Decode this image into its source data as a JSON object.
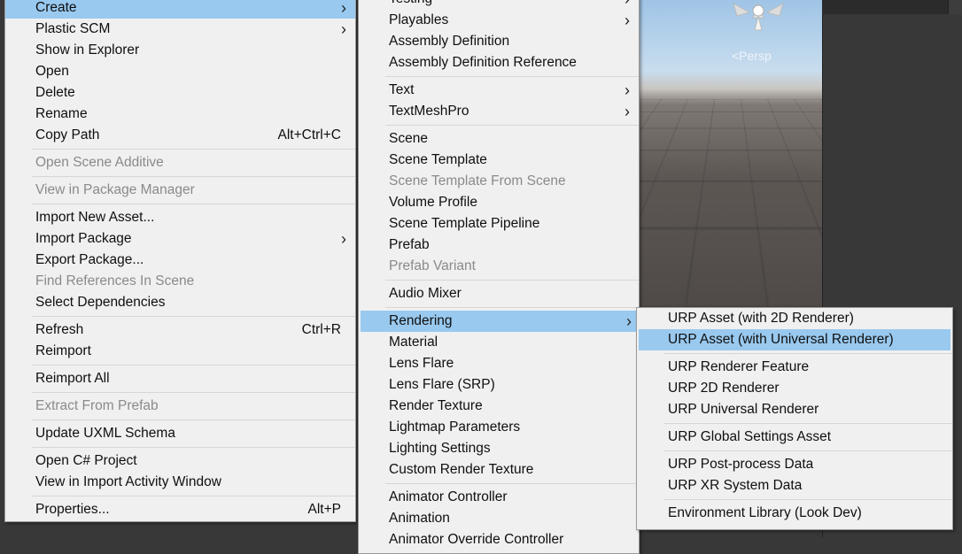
{
  "scene": {
    "persp_label": "<Persp"
  },
  "main_menu": {
    "items": [
      {
        "label": "Create",
        "submenu": true,
        "highlighted": true
      },
      {
        "label": "Plastic SCM",
        "submenu": true
      },
      {
        "label": "Show in Explorer"
      },
      {
        "label": "Open"
      },
      {
        "label": "Delete"
      },
      {
        "label": "Rename"
      },
      {
        "label": "Copy Path",
        "shortcut": "Alt+Ctrl+C"
      },
      {
        "separator": true
      },
      {
        "label": "Open Scene Additive",
        "disabled": true
      },
      {
        "separator": true
      },
      {
        "label": "View in Package Manager",
        "disabled": true
      },
      {
        "separator": true
      },
      {
        "label": "Import New Asset..."
      },
      {
        "label": "Import Package",
        "submenu": true
      },
      {
        "label": "Export Package..."
      },
      {
        "label": "Find References In Scene",
        "disabled": true
      },
      {
        "label": "Select Dependencies"
      },
      {
        "separator": true
      },
      {
        "label": "Refresh",
        "shortcut": "Ctrl+R"
      },
      {
        "label": "Reimport"
      },
      {
        "separator": true
      },
      {
        "label": "Reimport All"
      },
      {
        "separator": true
      },
      {
        "label": "Extract From Prefab",
        "disabled": true
      },
      {
        "separator": true
      },
      {
        "label": "Update UXML Schema"
      },
      {
        "separator": true
      },
      {
        "label": "Open C# Project"
      },
      {
        "label": "View in Import Activity Window"
      },
      {
        "separator": true
      },
      {
        "label": "Properties...",
        "shortcut": "Alt+P"
      }
    ]
  },
  "create_menu": {
    "items": [
      {
        "label": "Testing",
        "submenu": true
      },
      {
        "label": "Playables",
        "submenu": true
      },
      {
        "label": "Assembly Definition"
      },
      {
        "label": "Assembly Definition Reference"
      },
      {
        "separator": true
      },
      {
        "label": "Text",
        "submenu": true
      },
      {
        "label": "TextMeshPro",
        "submenu": true
      },
      {
        "separator": true
      },
      {
        "label": "Scene"
      },
      {
        "label": "Scene Template"
      },
      {
        "label": "Scene Template From Scene",
        "disabled": true
      },
      {
        "label": "Volume Profile"
      },
      {
        "label": "Scene Template Pipeline"
      },
      {
        "label": "Prefab"
      },
      {
        "label": "Prefab Variant",
        "disabled": true
      },
      {
        "separator": true
      },
      {
        "label": "Audio Mixer"
      },
      {
        "separator": true
      },
      {
        "label": "Rendering",
        "submenu": true,
        "highlighted": true
      },
      {
        "label": "Material"
      },
      {
        "label": "Lens Flare"
      },
      {
        "label": "Lens Flare (SRP)"
      },
      {
        "label": "Render Texture"
      },
      {
        "label": "Lightmap Parameters"
      },
      {
        "label": "Lighting Settings"
      },
      {
        "label": "Custom Render Texture"
      },
      {
        "separator": true
      },
      {
        "label": "Animator Controller"
      },
      {
        "label": "Animation"
      },
      {
        "label": "Animator Override Controller"
      }
    ]
  },
  "rendering_menu": {
    "items": [
      {
        "label": "URP Asset (with 2D Renderer)"
      },
      {
        "label": "URP Asset (with Universal Renderer)",
        "highlighted": true
      },
      {
        "separator": true
      },
      {
        "label": "URP Renderer Feature"
      },
      {
        "label": "URP 2D Renderer"
      },
      {
        "label": "URP Universal Renderer"
      },
      {
        "separator": true
      },
      {
        "label": "URP Global Settings Asset"
      },
      {
        "separator": true
      },
      {
        "label": "URP Post-process Data"
      },
      {
        "label": "URP XR System Data"
      },
      {
        "separator": true
      },
      {
        "label": "Environment Library (Look Dev)"
      }
    ]
  }
}
